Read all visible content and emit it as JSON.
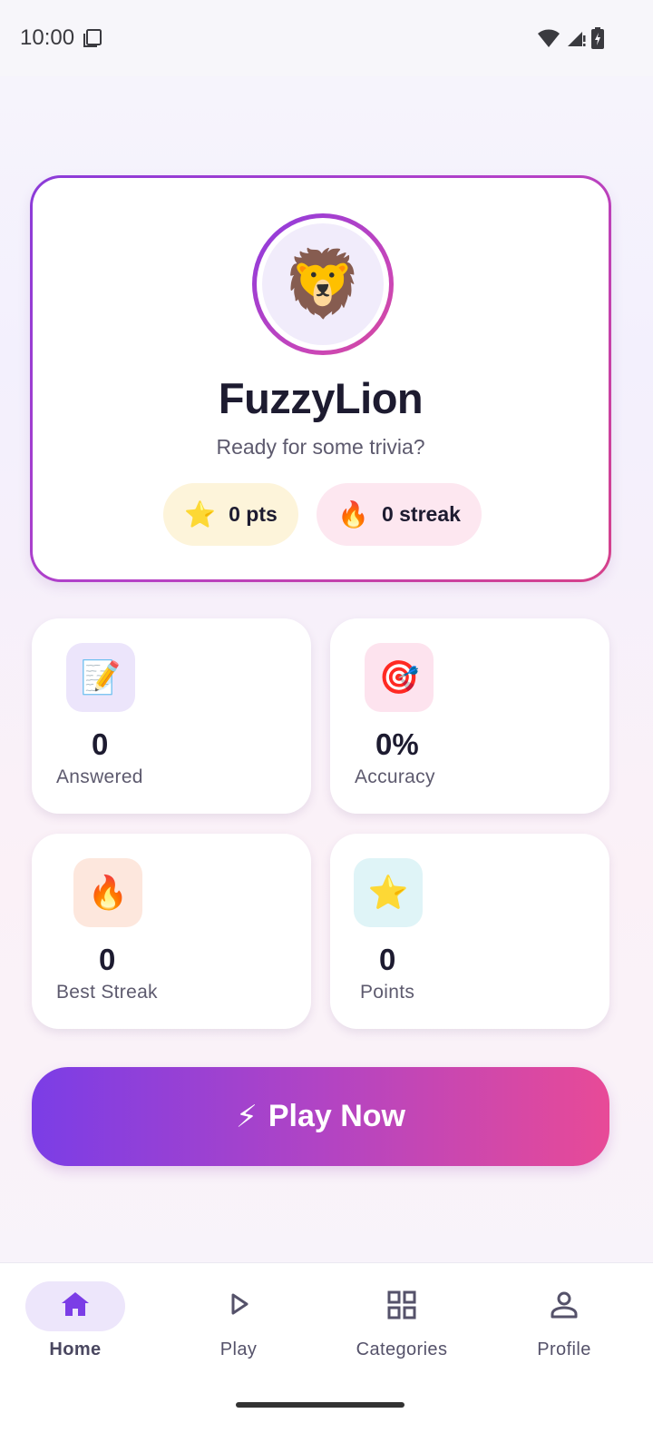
{
  "status_bar": {
    "time": "10:00"
  },
  "profile": {
    "avatar_emoji": "🦁",
    "username": "FuzzyLion",
    "tagline": "Ready for some trivia?",
    "points_icon": "⭐",
    "points_label": "0 pts",
    "streak_icon": "🔥",
    "streak_label": "0 streak"
  },
  "stats": [
    {
      "icon": "📝",
      "value": "0",
      "label": "Answered",
      "icon_bg": "#ece5fb"
    },
    {
      "icon": "🎯",
      "value": "0%",
      "label": "Accuracy",
      "icon_bg": "#fde3ee"
    },
    {
      "icon": "🔥",
      "value": "0",
      "label": "Best Streak",
      "icon_bg": "#fde7dd"
    },
    {
      "icon": "⭐",
      "value": "0",
      "label": "Points",
      "icon_bg": "#dff4f7"
    }
  ],
  "play_button": {
    "icon": "⚡",
    "label": "Play Now"
  },
  "bottom_nav": [
    {
      "label": "Home",
      "icon": "home-icon",
      "active": true
    },
    {
      "label": "Play",
      "icon": "play-icon",
      "active": false
    },
    {
      "label": "Categories",
      "icon": "grid-icon",
      "active": false
    },
    {
      "label": "Profile",
      "icon": "person-icon",
      "active": false
    }
  ],
  "colors": {
    "accent": "#7b3de6",
    "accent_end": "#e84a97",
    "nav_active_pill": "#ede6fb"
  }
}
